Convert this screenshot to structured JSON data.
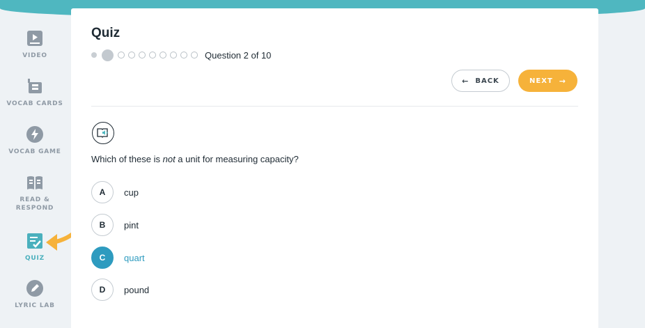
{
  "colors": {
    "teal": "#4fb7c0",
    "accent_orange": "#f6b23a",
    "selected_blue": "#2e9bbf",
    "active_nav": "#4ab0bd",
    "nav_gray": "#8f9aa5"
  },
  "sidebar": {
    "items": [
      {
        "label": "VIDEO",
        "icon": "video-icon"
      },
      {
        "label": "VOCAB CARDS",
        "icon": "vocab-cards-icon"
      },
      {
        "label": "VOCAB GAME",
        "icon": "lightning-icon"
      },
      {
        "label": "READ & RESPOND",
        "icon": "open-book-icon"
      },
      {
        "label": "QUIZ",
        "icon": "quiz-checklist-icon",
        "active": true
      },
      {
        "label": "LYRIC LAB",
        "icon": "pencil-icon"
      }
    ]
  },
  "quiz": {
    "title": "Quiz",
    "progress": {
      "current": 2,
      "total": 10,
      "text": "Question 2 of 10"
    },
    "back_label": "BACK",
    "next_label": "NEXT",
    "audio_icon": "read-aloud-icon",
    "question_pre": "Which of these is ",
    "question_em": "not",
    "question_post": " a unit for measuring capacity?",
    "options": [
      {
        "letter": "A",
        "text": "cup"
      },
      {
        "letter": "B",
        "text": "pint"
      },
      {
        "letter": "C",
        "text": "quart",
        "selected": true
      },
      {
        "letter": "D",
        "text": "pound"
      }
    ]
  }
}
